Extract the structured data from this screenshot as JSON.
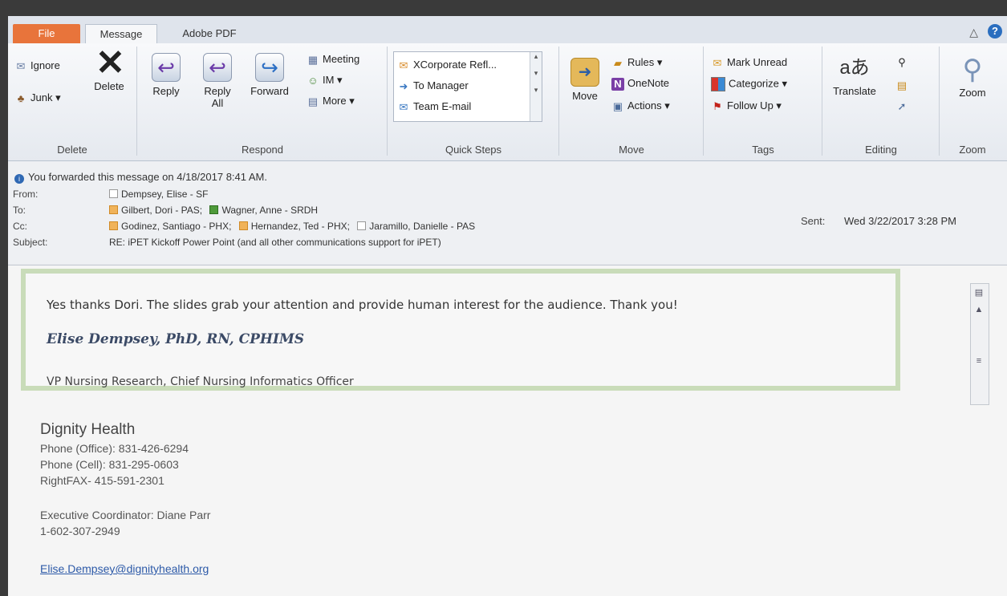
{
  "tabs": {
    "file": "File",
    "message": "Message",
    "adobe": "Adobe PDF"
  },
  "window": {
    "help_glyph": "?",
    "minimize_glyph": "△"
  },
  "ribbon": {
    "delete_group": {
      "label": "Delete",
      "ignore": "Ignore",
      "junk": "Junk ▾",
      "delete": "Delete"
    },
    "respond_group": {
      "label": "Respond",
      "reply": "Reply",
      "reply_all_1": "Reply",
      "reply_all_2": "All",
      "forward": "Forward",
      "meeting": "Meeting",
      "im": "IM ▾",
      "more": "More ▾"
    },
    "quick_steps": {
      "label": "Quick Steps",
      "items": [
        "XCorporate Refl...",
        "To Manager",
        "Team E-mail"
      ]
    },
    "move_group": {
      "label": "Move",
      "move": "Move",
      "rules": "Rules ▾",
      "onenote": "OneNote",
      "actions": "Actions ▾"
    },
    "tags_group": {
      "label": "Tags",
      "mark_unread": "Mark Unread",
      "categorize": "Categorize ▾",
      "follow_up": "Follow Up ▾"
    },
    "editing_group": {
      "label": "Editing",
      "translate": "Translate",
      "translate_glyph": "aあ"
    },
    "zoom_group": {
      "label": "Zoom",
      "zoom": "Zoom"
    }
  },
  "header": {
    "notice": "You forwarded this message on 4/18/2017 8:41 AM.",
    "from_label": "From:",
    "from": "Dempsey, Elise - SF",
    "to_label": "To:",
    "to": [
      "Gilbert, Dori - PAS;",
      "Wagner, Anne - SRDH"
    ],
    "cc_label": "Cc:",
    "cc": [
      "Godinez, Santiago - PHX;",
      "Hernandez, Ted - PHX;",
      "Jaramillo, Danielle  - PAS"
    ],
    "subject_label": "Subject:",
    "subject": "RE: iPET Kickoff Power Point (and all other communications support for iPET)",
    "sent_label": "Sent:",
    "sent": "Wed 3/22/2017 3:28 PM"
  },
  "message": {
    "line1": "Yes thanks Dori.  The slides grab your attention and provide human interest for the audience.  Thank you!",
    "signature_name": "Elise Dempsey, PhD, RN, CPHIMS",
    "signature_role": "VP Nursing Research, Chief Nursing Informatics Officer",
    "org": "Dignity Health",
    "phone_office": "Phone (Office):  831-426-6294",
    "phone_cell": "Phone (Cell):  831-295-0603",
    "fax": "RightFAX- 415-591-2301",
    "exec_coord": "Executive Coordinator:  Diane Parr",
    "exec_phone": "1-602-307-2949",
    "email": "Elise.Dempsey@dignityhealth.org"
  }
}
